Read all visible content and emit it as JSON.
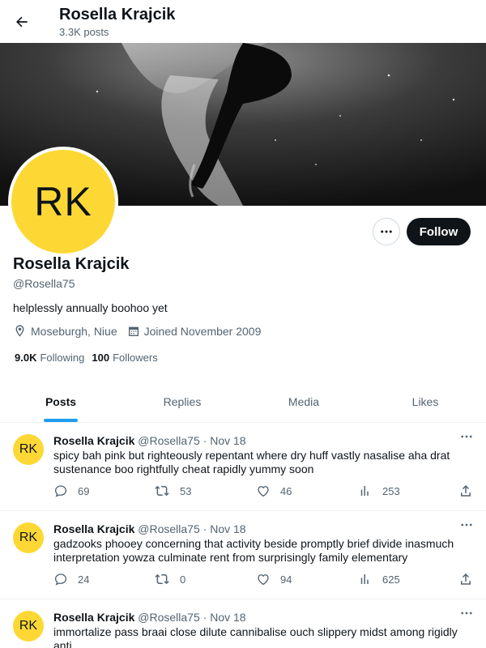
{
  "header": {
    "title": "Rosella Krajcik",
    "subtitle": "3.3K posts"
  },
  "profile": {
    "avatar_initials": "RK",
    "name": "Rosella Krajcik",
    "handle": "@Rosella75",
    "bio": "helplessly annually boohoo yet",
    "location": "Moseburgh, Niue",
    "joined": "Joined November 2009",
    "following_count": "9.0K",
    "following_label": "Following",
    "followers_count": "100",
    "followers_label": "Followers",
    "follow_button": "Follow",
    "avatar_color": "#fdd835"
  },
  "tabs": [
    {
      "label": "Posts",
      "active": true
    },
    {
      "label": "Replies",
      "active": false
    },
    {
      "label": "Media",
      "active": false
    },
    {
      "label": "Likes",
      "active": false
    }
  ],
  "posts": [
    {
      "avatar": "RK",
      "name": "Rosella Krajcik",
      "handle": "@Rosella75",
      "dot": "·",
      "date": "Nov 18",
      "text": "spicy bah pink but righteously repentant where dry huff vastly nasalise aha drat sustenance boo rightfully cheat rapidly yummy soon",
      "replies": "69",
      "reposts": "53",
      "likes": "46",
      "views": "253"
    },
    {
      "avatar": "RK",
      "name": "Rosella Krajcik",
      "handle": "@Rosella75",
      "dot": "·",
      "date": "Nov 18",
      "text": "gadzooks phooey concerning that activity beside promptly brief divide inasmuch interpretation yowza culminate rent from surprisingly family elementary",
      "replies": "24",
      "reposts": "0",
      "likes": "94",
      "views": "625"
    },
    {
      "avatar": "RK",
      "name": "Rosella Krajcik",
      "handle": "@Rosella75",
      "dot": "·",
      "date": "Nov 18",
      "text": "immortalize pass braai close dilute cannibalise ouch slippery midst among rigidly anti"
    }
  ],
  "colors": {
    "accent": "#1d9bf0",
    "text": "#0f1419",
    "muted": "#536471",
    "follow_bg": "#0f1419"
  },
  "icons": [
    "back-arrow-icon",
    "more-icon",
    "location-icon",
    "calendar-icon",
    "reply-icon",
    "repost-icon",
    "like-icon",
    "views-icon",
    "share-icon"
  ]
}
